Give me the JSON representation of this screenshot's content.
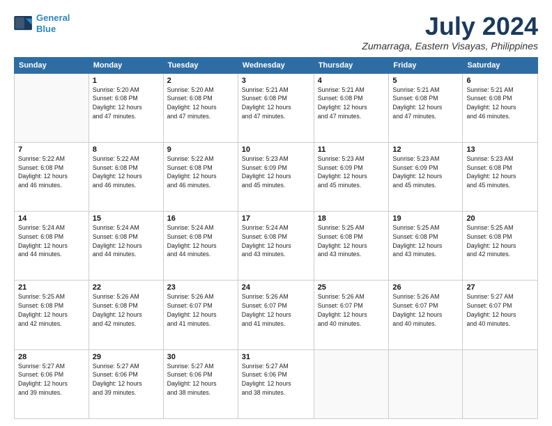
{
  "header": {
    "logo_line1": "General",
    "logo_line2": "Blue",
    "main_title": "July 2024",
    "subtitle": "Zumarraga, Eastern Visayas, Philippines"
  },
  "weekdays": [
    "Sunday",
    "Monday",
    "Tuesday",
    "Wednesday",
    "Thursday",
    "Friday",
    "Saturday"
  ],
  "weeks": [
    [
      {
        "day": "",
        "info": ""
      },
      {
        "day": "1",
        "info": "Sunrise: 5:20 AM\nSunset: 6:08 PM\nDaylight: 12 hours\nand 47 minutes."
      },
      {
        "day": "2",
        "info": "Sunrise: 5:20 AM\nSunset: 6:08 PM\nDaylight: 12 hours\nand 47 minutes."
      },
      {
        "day": "3",
        "info": "Sunrise: 5:21 AM\nSunset: 6:08 PM\nDaylight: 12 hours\nand 47 minutes."
      },
      {
        "day": "4",
        "info": "Sunrise: 5:21 AM\nSunset: 6:08 PM\nDaylight: 12 hours\nand 47 minutes."
      },
      {
        "day": "5",
        "info": "Sunrise: 5:21 AM\nSunset: 6:08 PM\nDaylight: 12 hours\nand 47 minutes."
      },
      {
        "day": "6",
        "info": "Sunrise: 5:21 AM\nSunset: 6:08 PM\nDaylight: 12 hours\nand 46 minutes."
      }
    ],
    [
      {
        "day": "7",
        "info": "Sunrise: 5:22 AM\nSunset: 6:08 PM\nDaylight: 12 hours\nand 46 minutes."
      },
      {
        "day": "8",
        "info": "Sunrise: 5:22 AM\nSunset: 6:08 PM\nDaylight: 12 hours\nand 46 minutes."
      },
      {
        "day": "9",
        "info": "Sunrise: 5:22 AM\nSunset: 6:08 PM\nDaylight: 12 hours\nand 46 minutes."
      },
      {
        "day": "10",
        "info": "Sunrise: 5:23 AM\nSunset: 6:09 PM\nDaylight: 12 hours\nand 45 minutes."
      },
      {
        "day": "11",
        "info": "Sunrise: 5:23 AM\nSunset: 6:09 PM\nDaylight: 12 hours\nand 45 minutes."
      },
      {
        "day": "12",
        "info": "Sunrise: 5:23 AM\nSunset: 6:09 PM\nDaylight: 12 hours\nand 45 minutes."
      },
      {
        "day": "13",
        "info": "Sunrise: 5:23 AM\nSunset: 6:08 PM\nDaylight: 12 hours\nand 45 minutes."
      }
    ],
    [
      {
        "day": "14",
        "info": "Sunrise: 5:24 AM\nSunset: 6:08 PM\nDaylight: 12 hours\nand 44 minutes."
      },
      {
        "day": "15",
        "info": "Sunrise: 5:24 AM\nSunset: 6:08 PM\nDaylight: 12 hours\nand 44 minutes."
      },
      {
        "day": "16",
        "info": "Sunrise: 5:24 AM\nSunset: 6:08 PM\nDaylight: 12 hours\nand 44 minutes."
      },
      {
        "day": "17",
        "info": "Sunrise: 5:24 AM\nSunset: 6:08 PM\nDaylight: 12 hours\nand 43 minutes."
      },
      {
        "day": "18",
        "info": "Sunrise: 5:25 AM\nSunset: 6:08 PM\nDaylight: 12 hours\nand 43 minutes."
      },
      {
        "day": "19",
        "info": "Sunrise: 5:25 AM\nSunset: 6:08 PM\nDaylight: 12 hours\nand 43 minutes."
      },
      {
        "day": "20",
        "info": "Sunrise: 5:25 AM\nSunset: 6:08 PM\nDaylight: 12 hours\nand 42 minutes."
      }
    ],
    [
      {
        "day": "21",
        "info": "Sunrise: 5:25 AM\nSunset: 6:08 PM\nDaylight: 12 hours\nand 42 minutes."
      },
      {
        "day": "22",
        "info": "Sunrise: 5:26 AM\nSunset: 6:08 PM\nDaylight: 12 hours\nand 42 minutes."
      },
      {
        "day": "23",
        "info": "Sunrise: 5:26 AM\nSunset: 6:07 PM\nDaylight: 12 hours\nand 41 minutes."
      },
      {
        "day": "24",
        "info": "Sunrise: 5:26 AM\nSunset: 6:07 PM\nDaylight: 12 hours\nand 41 minutes."
      },
      {
        "day": "25",
        "info": "Sunrise: 5:26 AM\nSunset: 6:07 PM\nDaylight: 12 hours\nand 40 minutes."
      },
      {
        "day": "26",
        "info": "Sunrise: 5:26 AM\nSunset: 6:07 PM\nDaylight: 12 hours\nand 40 minutes."
      },
      {
        "day": "27",
        "info": "Sunrise: 5:27 AM\nSunset: 6:07 PM\nDaylight: 12 hours\nand 40 minutes."
      }
    ],
    [
      {
        "day": "28",
        "info": "Sunrise: 5:27 AM\nSunset: 6:06 PM\nDaylight: 12 hours\nand 39 minutes."
      },
      {
        "day": "29",
        "info": "Sunrise: 5:27 AM\nSunset: 6:06 PM\nDaylight: 12 hours\nand 39 minutes."
      },
      {
        "day": "30",
        "info": "Sunrise: 5:27 AM\nSunset: 6:06 PM\nDaylight: 12 hours\nand 38 minutes."
      },
      {
        "day": "31",
        "info": "Sunrise: 5:27 AM\nSunset: 6:06 PM\nDaylight: 12 hours\nand 38 minutes."
      },
      {
        "day": "",
        "info": ""
      },
      {
        "day": "",
        "info": ""
      },
      {
        "day": "",
        "info": ""
      }
    ]
  ]
}
